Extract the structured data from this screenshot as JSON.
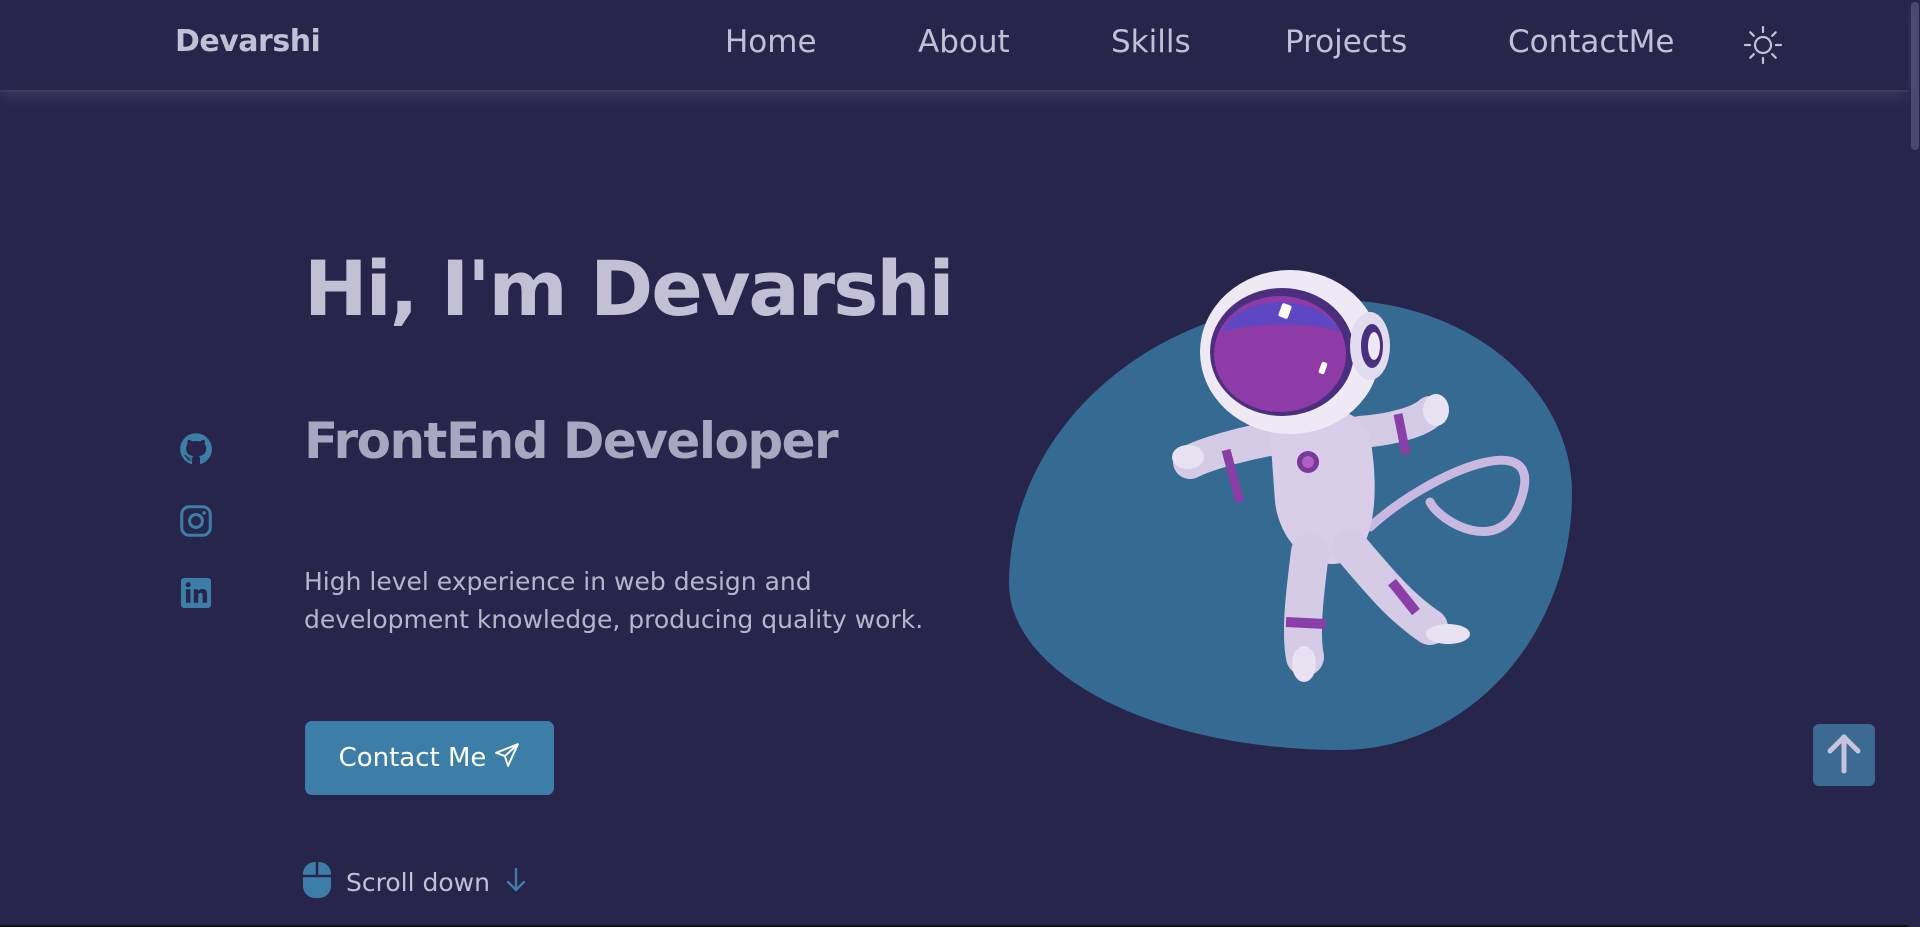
{
  "header": {
    "logo": "Devarshi",
    "nav": [
      {
        "label": "Home"
      },
      {
        "label": "About"
      },
      {
        "label": "Skills"
      },
      {
        "label": "Projects"
      },
      {
        "label": "ContactMe"
      }
    ],
    "theme_icon": "sun-icon"
  },
  "social": [
    {
      "icon": "github-icon"
    },
    {
      "icon": "instagram-icon"
    },
    {
      "icon": "linkedin-icon"
    }
  ],
  "hero": {
    "title": "Hi, I'm Devarshi",
    "subtitle": "FrontEnd Developer",
    "description": "High level experience in web design and development knowledge, producing quality work.",
    "contact_button": "Contact Me",
    "contact_icon": "send-icon",
    "scroll_label": "Scroll down",
    "scroll_icon": "mouse-icon",
    "scroll_arrow_icon": "arrow-down-icon"
  },
  "scroll_up_icon": "arrow-up-icon",
  "colors": {
    "background": "#27254c",
    "accent": "#3d7ea8",
    "blob": "#356a92",
    "text": "#c3bfd4"
  }
}
